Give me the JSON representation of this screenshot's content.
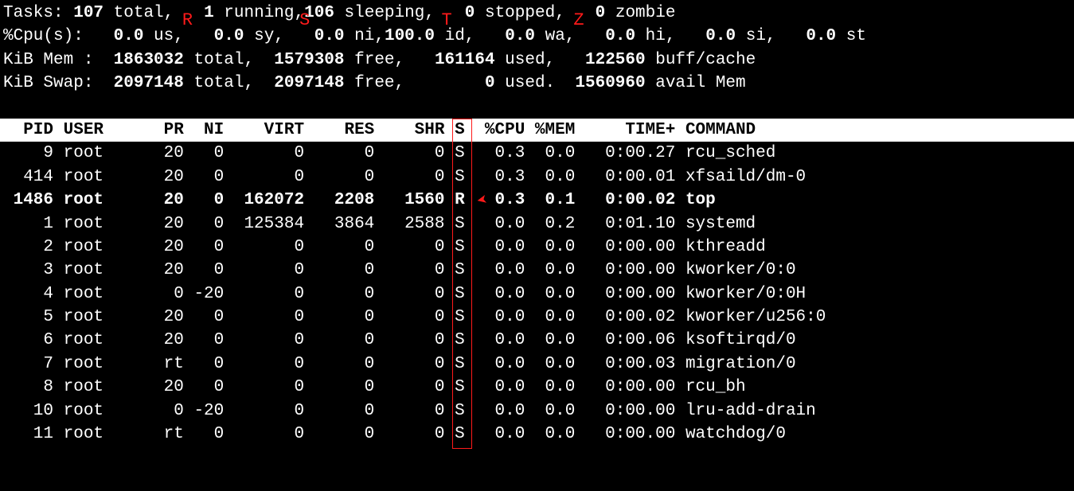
{
  "summary": {
    "tasks": {
      "label": "Tasks:",
      "total": "107",
      "total_lbl": "total,",
      "running": "1",
      "running_lbl": "running,",
      "sleeping": "106",
      "sleeping_lbl": "sleeping,",
      "stopped": "0",
      "stopped_lbl": "stopped,",
      "zombie": "0",
      "zombie_lbl": "zombie",
      "anno_R": "R",
      "anno_S": "S",
      "anno_T": "T",
      "anno_Z": "Z"
    },
    "cpu": {
      "label": "%Cpu(s):",
      "us": "0.0",
      "us_lbl": "us,",
      "sy": "0.0",
      "sy_lbl": "sy,",
      "ni": "0.0",
      "ni_lbl": "ni,",
      "id": "100.0",
      "id_lbl": "id,",
      "wa": "0.0",
      "wa_lbl": "wa,",
      "hi": "0.0",
      "hi_lbl": "hi,",
      "si": "0.0",
      "si_lbl": "si,",
      "st": "0.0",
      "st_lbl": "st"
    },
    "mem": {
      "label": "KiB Mem :",
      "total": "1863032",
      "total_lbl": "total,",
      "free": "1579308",
      "free_lbl": "free,",
      "used": "161164",
      "used_lbl": "used,",
      "cache": "122560",
      "cache_lbl": "buff/cache"
    },
    "swap": {
      "label": "KiB Swap:",
      "total": "2097148",
      "total_lbl": "total,",
      "free": "2097148",
      "free_lbl": "free,",
      "used": "0",
      "used_lbl": "used.",
      "avail": "1560960",
      "avail_lbl": "avail Mem"
    }
  },
  "columns": {
    "pid": "PID",
    "user": "USER",
    "pr": "PR",
    "ni": "NI",
    "virt": "VIRT",
    "res": "RES",
    "shr": "SHR",
    "s": "S",
    "cpu": "%CPU",
    "mem": "%MEM",
    "time": "TIME+",
    "command": "COMMAND"
  },
  "rows": [
    {
      "pid": "9",
      "user": "root",
      "pr": "20",
      "ni": "0",
      "virt": "0",
      "res": "0",
      "shr": "0",
      "s": "S",
      "cpu": "0.3",
      "mem": "0.0",
      "time": "0:00.27",
      "command": "rcu_sched",
      "bold": false
    },
    {
      "pid": "414",
      "user": "root",
      "pr": "20",
      "ni": "0",
      "virt": "0",
      "res": "0",
      "shr": "0",
      "s": "S",
      "cpu": "0.3",
      "mem": "0.0",
      "time": "0:00.01",
      "command": "xfsaild/dm-0",
      "bold": false
    },
    {
      "pid": "1486",
      "user": "root",
      "pr": "20",
      "ni": "0",
      "virt": "162072",
      "res": "2208",
      "shr": "1560",
      "s": "R",
      "cpu": "0.3",
      "mem": "0.1",
      "time": "0:00.02",
      "command": "top",
      "bold": true
    },
    {
      "pid": "1",
      "user": "root",
      "pr": "20",
      "ni": "0",
      "virt": "125384",
      "res": "3864",
      "shr": "2588",
      "s": "S",
      "cpu": "0.0",
      "mem": "0.2",
      "time": "0:01.10",
      "command": "systemd",
      "bold": false
    },
    {
      "pid": "2",
      "user": "root",
      "pr": "20",
      "ni": "0",
      "virt": "0",
      "res": "0",
      "shr": "0",
      "s": "S",
      "cpu": "0.0",
      "mem": "0.0",
      "time": "0:00.00",
      "command": "kthreadd",
      "bold": false
    },
    {
      "pid": "3",
      "user": "root",
      "pr": "20",
      "ni": "0",
      "virt": "0",
      "res": "0",
      "shr": "0",
      "s": "S",
      "cpu": "0.0",
      "mem": "0.0",
      "time": "0:00.00",
      "command": "kworker/0:0",
      "bold": false
    },
    {
      "pid": "4",
      "user": "root",
      "pr": "0",
      "ni": "-20",
      "virt": "0",
      "res": "0",
      "shr": "0",
      "s": "S",
      "cpu": "0.0",
      "mem": "0.0",
      "time": "0:00.00",
      "command": "kworker/0:0H",
      "bold": false
    },
    {
      "pid": "5",
      "user": "root",
      "pr": "20",
      "ni": "0",
      "virt": "0",
      "res": "0",
      "shr": "0",
      "s": "S",
      "cpu": "0.0",
      "mem": "0.0",
      "time": "0:00.02",
      "command": "kworker/u256:0",
      "bold": false
    },
    {
      "pid": "6",
      "user": "root",
      "pr": "20",
      "ni": "0",
      "virt": "0",
      "res": "0",
      "shr": "0",
      "s": "S",
      "cpu": "0.0",
      "mem": "0.0",
      "time": "0:00.06",
      "command": "ksoftirqd/0",
      "bold": false
    },
    {
      "pid": "7",
      "user": "root",
      "pr": "rt",
      "ni": "0",
      "virt": "0",
      "res": "0",
      "shr": "0",
      "s": "S",
      "cpu": "0.0",
      "mem": "0.0",
      "time": "0:00.03",
      "command": "migration/0",
      "bold": false
    },
    {
      "pid": "8",
      "user": "root",
      "pr": "20",
      "ni": "0",
      "virt": "0",
      "res": "0",
      "shr": "0",
      "s": "S",
      "cpu": "0.0",
      "mem": "0.0",
      "time": "0:00.00",
      "command": "rcu_bh",
      "bold": false
    },
    {
      "pid": "10",
      "user": "root",
      "pr": "0",
      "ni": "-20",
      "virt": "0",
      "res": "0",
      "shr": "0",
      "s": "S",
      "cpu": "0.0",
      "mem": "0.0",
      "time": "0:00.00",
      "command": "lru-add-drain",
      "bold": false
    },
    {
      "pid": "11",
      "user": "root",
      "pr": "rt",
      "ni": "0",
      "virt": "0",
      "res": "0",
      "shr": "0",
      "s": "S",
      "cpu": "0.0",
      "mem": "0.0",
      "time": "0:00.00",
      "command": "watchdog/0",
      "bold": false
    }
  ],
  "annotations": {
    "s_column_box": true,
    "arrow_to_R": true
  }
}
